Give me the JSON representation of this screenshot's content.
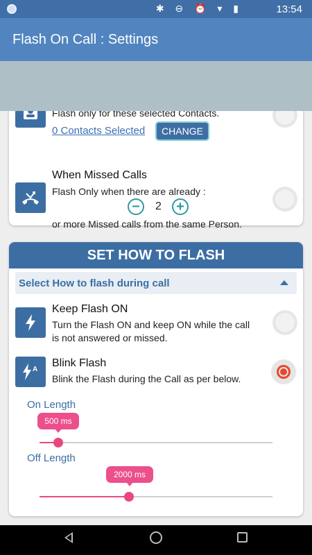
{
  "status_bar": {
    "icons": "✱ ⊖ ⏰ ▾ ▮",
    "time": "13:54"
  },
  "app_bar": {
    "title": "Flash On Call : Settings"
  },
  "contacts_option": {
    "description": "Flash only for these selected Contacts.",
    "link": "0 Contacts Selected",
    "change_button": "CHANGE"
  },
  "missed_calls_option": {
    "title": "When Missed Calls",
    "line1": "Flash Only when there are already :",
    "stepper_minus": "−",
    "stepper_value": "2",
    "stepper_plus": "+",
    "line2": "or more Missed calls from the same Person."
  },
  "flash_section": {
    "header": "SET HOW TO FLASH",
    "subheader": "Select How to flash during call",
    "keep_on": {
      "title": "Keep Flash ON",
      "line1": "Turn the Flash ON and keep ON while the call",
      "line2": "is not answered or missed.",
      "selected": false
    },
    "blink": {
      "title": "Blink Flash",
      "line1": "Blink the Flash during the Call as per below.",
      "selected": true
    },
    "on_length": {
      "label": "On Length",
      "value_label": "500 ms",
      "value": 500
    },
    "off_length": {
      "label": "Off Length",
      "value_label": "2000 ms",
      "value": 2000
    }
  },
  "colors": {
    "status_bar": "#3f6fa6",
    "app_bar": "#5285bf",
    "accent": "#3d6ea3",
    "slider": "#e8487f",
    "radio_selected": "#e8472c"
  }
}
